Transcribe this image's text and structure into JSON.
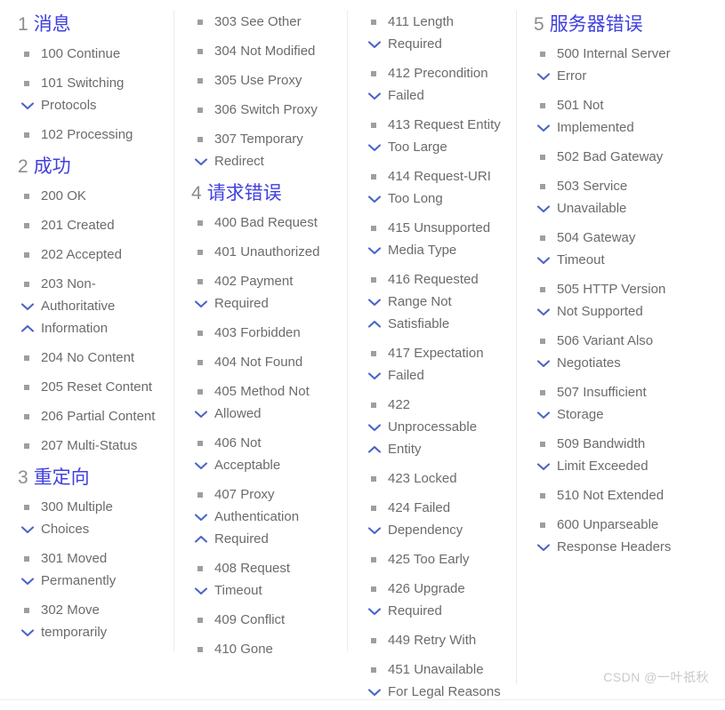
{
  "page": {
    "title": "HTTP Status Codes Reference",
    "watermark": "CSDN @一叶祇秋",
    "colors": {
      "heading_number": "#8d8d8d",
      "heading_title": "#4040e0",
      "item_text": "#6b6b6b",
      "bullet_square": "#9e9e9e",
      "chevron": "#4a64c8",
      "divider": "#ebebeb",
      "watermark": "#c9c9c9",
      "background": "#ffffff"
    },
    "markers": {
      "line1": "square-bullet-icon",
      "line2": "chevron-down-icon",
      "line3": "chevron-up-icon"
    }
  },
  "columns": [
    {
      "id": "column-1",
      "blocks": [
        {
          "type": "heading",
          "number": "1",
          "title": "消息"
        },
        {
          "type": "list",
          "items": [
            {
              "lines": [
                "100 Continue"
              ]
            },
            {
              "lines": [
                "101 Switching",
                "Protocols"
              ]
            },
            {
              "lines": [
                "102 Processing"
              ]
            }
          ]
        },
        {
          "type": "heading",
          "number": "2",
          "title": "成功"
        },
        {
          "type": "list",
          "items": [
            {
              "lines": [
                "200 OK"
              ]
            },
            {
              "lines": [
                "201 Created"
              ]
            },
            {
              "lines": [
                "202 Accepted"
              ]
            },
            {
              "lines": [
                "203 Non-",
                "Authoritative",
                "Information"
              ]
            },
            {
              "lines": [
                "204 No Content"
              ]
            },
            {
              "lines": [
                "205 Reset Content"
              ]
            },
            {
              "lines": [
                "206 Partial Content"
              ]
            },
            {
              "lines": [
                "207 Multi-Status"
              ]
            }
          ]
        },
        {
          "type": "heading",
          "number": "3",
          "title": "重定向"
        },
        {
          "type": "list",
          "items": [
            {
              "lines": [
                "300 Multiple",
                "Choices"
              ]
            },
            {
              "lines": [
                "301 Moved",
                "Permanently"
              ]
            },
            {
              "lines": [
                "302 Move",
                "temporarily"
              ]
            }
          ]
        }
      ]
    },
    {
      "id": "column-2",
      "blocks": [
        {
          "type": "list",
          "items": [
            {
              "lines": [
                "303 See Other"
              ]
            },
            {
              "lines": [
                "304 Not Modified"
              ]
            },
            {
              "lines": [
                "305 Use Proxy"
              ]
            },
            {
              "lines": [
                "306 Switch Proxy"
              ]
            },
            {
              "lines": [
                "307 Temporary",
                "Redirect"
              ]
            }
          ]
        },
        {
          "type": "heading",
          "number": "4",
          "title": "请求错误"
        },
        {
          "type": "list",
          "items": [
            {
              "lines": [
                "400 Bad Request"
              ]
            },
            {
              "lines": [
                "401 Unauthorized"
              ]
            },
            {
              "lines": [
                "402 Payment",
                "Required"
              ]
            },
            {
              "lines": [
                "403 Forbidden"
              ]
            },
            {
              "lines": [
                "404 Not Found"
              ]
            },
            {
              "lines": [
                "405 Method Not",
                "Allowed"
              ]
            },
            {
              "lines": [
                "406 Not",
                "Acceptable"
              ]
            },
            {
              "lines": [
                "407 Proxy",
                "Authentication",
                "Required"
              ]
            },
            {
              "lines": [
                "408 Request",
                "Timeout"
              ]
            },
            {
              "lines": [
                "409 Conflict"
              ]
            },
            {
              "lines": [
                "410 Gone"
              ]
            }
          ]
        }
      ]
    },
    {
      "id": "column-3",
      "blocks": [
        {
          "type": "list",
          "items": [
            {
              "lines": [
                "411 Length",
                "Required"
              ]
            },
            {
              "lines": [
                "412 Precondition",
                "Failed"
              ]
            },
            {
              "lines": [
                "413 Request Entity",
                "Too Large"
              ]
            },
            {
              "lines": [
                "414 Request-URI",
                "Too Long"
              ]
            },
            {
              "lines": [
                "415 Unsupported",
                "Media Type"
              ]
            },
            {
              "lines": [
                "416 Requested",
                "Range Not",
                "Satisfiable"
              ]
            },
            {
              "lines": [
                "417 Expectation",
                "Failed"
              ]
            },
            {
              "lines": [
                "422",
                "Unprocessable",
                "Entity"
              ]
            },
            {
              "lines": [
                "423 Locked"
              ]
            },
            {
              "lines": [
                "424 Failed",
                "Dependency"
              ]
            },
            {
              "lines": [
                "425 Too Early"
              ]
            },
            {
              "lines": [
                "426 Upgrade",
                "Required"
              ]
            },
            {
              "lines": [
                "449 Retry With"
              ]
            },
            {
              "lines": [
                "451 Unavailable",
                "For Legal Reasons"
              ]
            }
          ]
        }
      ]
    },
    {
      "id": "column-4",
      "blocks": [
        {
          "type": "heading",
          "number": "5",
          "title": "服务器错误"
        },
        {
          "type": "list",
          "items": [
            {
              "lines": [
                "500 Internal Server",
                "Error"
              ]
            },
            {
              "lines": [
                "501 Not",
                "Implemented"
              ]
            },
            {
              "lines": [
                "502 Bad Gateway"
              ]
            },
            {
              "lines": [
                "503 Service",
                "Unavailable"
              ]
            },
            {
              "lines": [
                "504 Gateway",
                "Timeout"
              ]
            },
            {
              "lines": [
                "505 HTTP Version",
                "Not Supported"
              ]
            },
            {
              "lines": [
                "506 Variant Also",
                "Negotiates"
              ]
            },
            {
              "lines": [
                "507 Insufficient",
                "Storage"
              ]
            },
            {
              "lines": [
                "509 Bandwidth",
                "Limit Exceeded"
              ]
            },
            {
              "lines": [
                "510 Not Extended"
              ]
            },
            {
              "lines": [
                "600 Unparseable",
                "Response Headers"
              ]
            }
          ]
        }
      ]
    }
  ]
}
